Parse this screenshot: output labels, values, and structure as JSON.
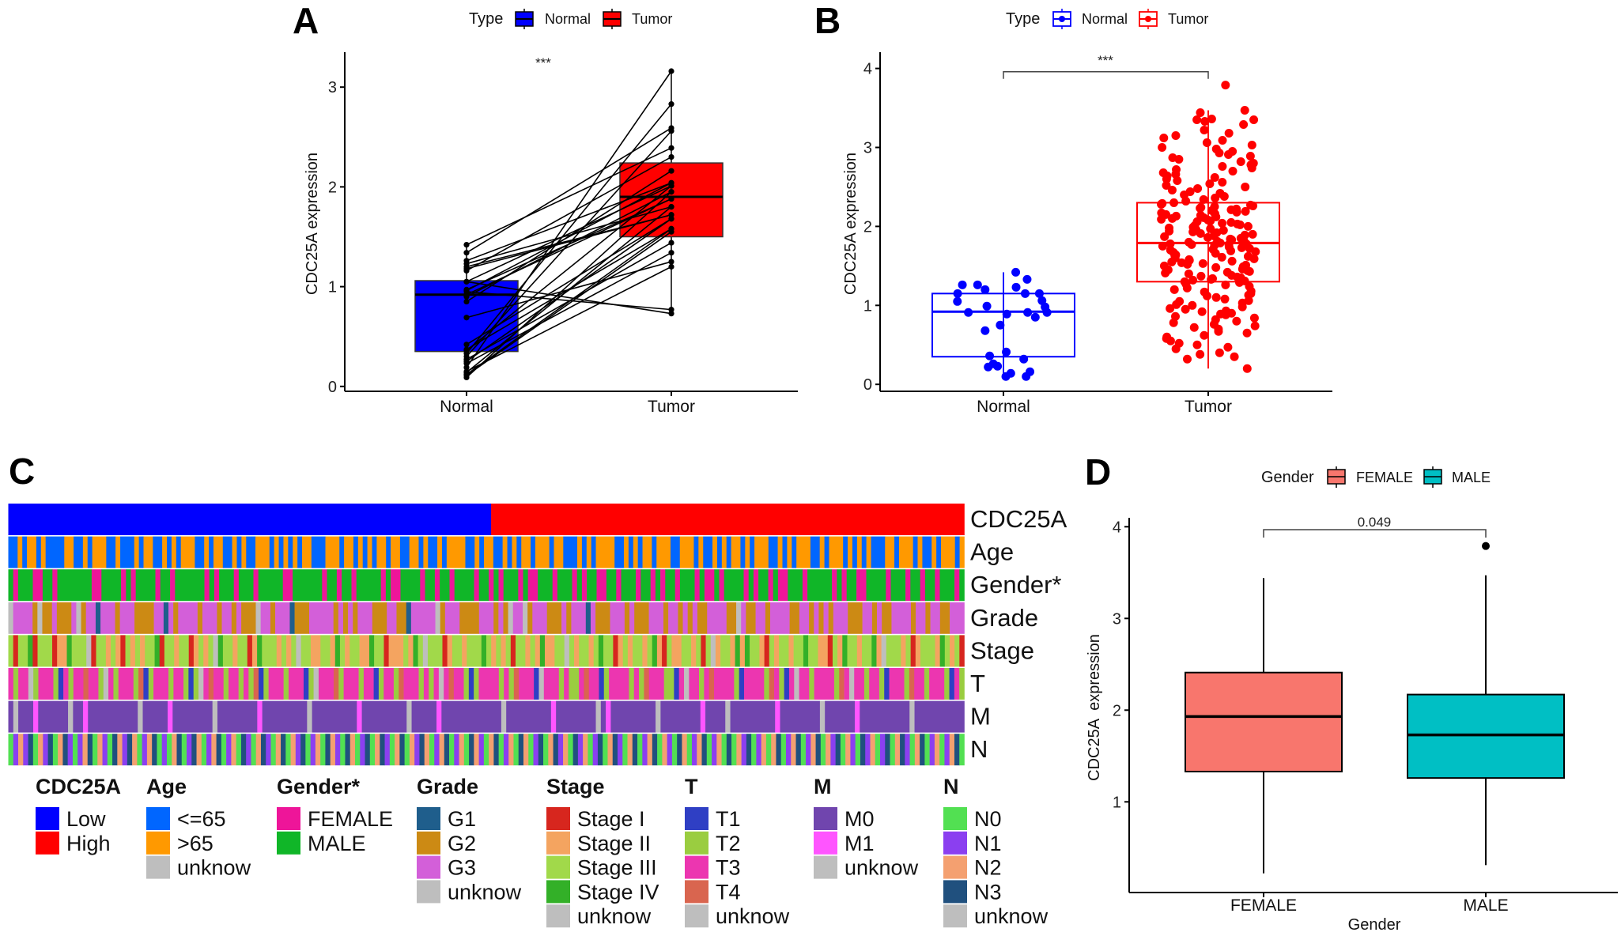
{
  "chart_data": [
    {
      "panel": "A",
      "type": "box+paired-line",
      "title": "",
      "xlabel": "",
      "ylabel": "CDC25A expression",
      "ylim": [
        0,
        3.3
      ],
      "yticks": [
        0,
        1,
        2,
        3
      ],
      "categories": [
        "Normal",
        "Tumor"
      ],
      "significance": "***",
      "legend": {
        "title": "Type",
        "position": "top",
        "items": [
          {
            "label": "Normal",
            "color": "#0000FF"
          },
          {
            "label": "Tumor",
            "color": "#FF0000"
          }
        ]
      },
      "boxes": [
        {
          "category": "Normal",
          "q1": 0.35,
          "median": 0.92,
          "q3": 1.06,
          "whisker_low": 0.09,
          "whisker_high": 1.42,
          "fill": "#0000FF"
        },
        {
          "category": "Tumor",
          "q1": 1.5,
          "median": 1.9,
          "q3": 2.24,
          "whisker_low": 0.73,
          "whisker_high": 3.16,
          "fill": "#FF0000"
        }
      ],
      "pairs": {
        "normal": [
          1.42,
          1.34,
          1.26,
          1.23,
          1.2,
          1.16,
          1.05,
          0.97,
          0.95,
          0.9,
          0.85,
          0.69,
          0.42,
          0.37,
          0.33,
          0.3,
          0.27,
          0.23,
          0.19,
          0.15,
          0.11,
          0.09,
          1.18,
          1.05,
          0.96,
          0.92,
          0.36,
          0.25,
          0.14,
          0.12
        ],
        "tumor": [
          2.39,
          2.59,
          2.04,
          1.8,
          1.72,
          2.3,
          2.01,
          1.88,
          0.77,
          1.95,
          2.16,
          1.25,
          1.68,
          1.58,
          2.83,
          2.56,
          1.44,
          1.34,
          3.16,
          1.2,
          1.55,
          1.95,
          1.72,
          0.73,
          2.04,
          1.88,
          2.01,
          1.68,
          1.8,
          1.58
        ]
      }
    },
    {
      "panel": "B",
      "type": "box+jitter",
      "xlabel": "",
      "ylabel": "CDC25A expression",
      "ylim": [
        0,
        4.1
      ],
      "yticks": [
        0,
        1,
        2,
        3,
        4
      ],
      "categories": [
        "Normal",
        "Tumor"
      ],
      "significance": "***",
      "legend": {
        "title": "Type",
        "position": "top",
        "items": [
          {
            "label": "Normal",
            "color": "#0000FF"
          },
          {
            "label": "Tumor",
            "color": "#FF0000"
          }
        ]
      },
      "boxes": [
        {
          "category": "Normal",
          "q1": 0.35,
          "median": 0.92,
          "q3": 1.15,
          "whisker_low": 0.1,
          "whisker_high": 1.42,
          "color": "#0000FF"
        },
        {
          "category": "Tumor",
          "q1": 1.3,
          "median": 1.79,
          "q3": 2.3,
          "whisker_low": 0.2,
          "whisker_high": 3.47,
          "color": "#FF0000"
        }
      ],
      "points": {
        "Normal": [
          1.42,
          1.33,
          1.26,
          1.26,
          1.23,
          1.2,
          1.15,
          1.15,
          1.15,
          1.06,
          1.05,
          0.99,
          0.98,
          0.91,
          0.91,
          0.91,
          0.89,
          0.85,
          0.75,
          0.68,
          0.41,
          0.36,
          0.32,
          0.26,
          0.23,
          0.22,
          0.16,
          0.14,
          0.1,
          0.1
        ],
        "Tumor": [
          0.2,
          0.32,
          0.35,
          0.38,
          0.4,
          0.45,
          0.47,
          0.5,
          0.52,
          0.55,
          0.58,
          0.6,
          0.62,
          0.65,
          0.67,
          0.7,
          0.72,
          0.74,
          0.76,
          0.78,
          0.8,
          0.82,
          0.84,
          0.86,
          0.88,
          0.89,
          0.9,
          0.92,
          0.93,
          0.95,
          0.96,
          0.98,
          1.0,
          1.01,
          1.03,
          1.05,
          1.06,
          1.08,
          1.1,
          1.12,
          1.13,
          1.15,
          1.17,
          1.18,
          1.2,
          1.22,
          1.24,
          1.26,
          1.27,
          1.29,
          1.3,
          1.31,
          1.32,
          1.33,
          1.34,
          1.35,
          1.36,
          1.37,
          1.38,
          1.4,
          1.41,
          1.42,
          1.43,
          1.44,
          1.45,
          1.46,
          1.48,
          1.49,
          1.5,
          1.51,
          1.52,
          1.53,
          1.54,
          1.55,
          1.56,
          1.57,
          1.58,
          1.59,
          1.6,
          1.61,
          1.62,
          1.63,
          1.64,
          1.65,
          1.66,
          1.67,
          1.68,
          1.69,
          1.7,
          1.71,
          1.72,
          1.73,
          1.74,
          1.75,
          1.76,
          1.77,
          1.77,
          1.78,
          1.78,
          1.79,
          1.8,
          1.81,
          1.82,
          1.83,
          1.84,
          1.85,
          1.86,
          1.87,
          1.88,
          1.89,
          1.9,
          1.91,
          1.92,
          1.93,
          1.94,
          1.95,
          1.96,
          1.97,
          1.98,
          1.99,
          2.0,
          2.01,
          2.02,
          2.03,
          2.04,
          2.05,
          2.06,
          2.07,
          2.08,
          2.09,
          2.1,
          2.11,
          2.12,
          2.13,
          2.14,
          2.15,
          2.16,
          2.17,
          2.18,
          2.19,
          2.2,
          2.21,
          2.22,
          2.23,
          2.24,
          2.25,
          2.26,
          2.27,
          2.28,
          2.29,
          2.3,
          2.32,
          2.34,
          2.36,
          2.38,
          2.4,
          2.42,
          2.44,
          2.46,
          2.48,
          2.5,
          2.52,
          2.54,
          2.56,
          2.58,
          2.6,
          2.62,
          2.64,
          2.66,
          2.68,
          2.7,
          2.72,
          2.74,
          2.76,
          2.78,
          2.8,
          2.82,
          2.85,
          2.87,
          2.89,
          2.91,
          2.93,
          2.95,
          2.98,
          3.0,
          3.03,
          3.06,
          3.09,
          3.12,
          3.15,
          3.18,
          3.22,
          3.29,
          3.33,
          3.35,
          3.35,
          3.36,
          3.44,
          3.47,
          3.79
        ]
      }
    },
    {
      "panel": "C",
      "type": "heatmap",
      "description": "Clinical annotation heatmap sorted by CDC25A expression (Low | High)",
      "rows": [
        {
          "name": "CDC25A",
          "codes": "LLLLLLLLLLLLLLLLLLLLLLLLLLLLLLLLLLLLLLLLLLLLLLLLLLLLLLLLLLLLLLLLLLLLLLLLLLLLLLLLLLLLLLLLLLLLLLLLLLLLHHHHHHHHHHHHHHHHHHHHHHHHHHHHHHHHHHHHHHHHHHHHHHHHHHHHHHHHHHHHHHHHHHHHHHHHHHHHHHHHHHHHHHHHHHHHHHHHHH"
        },
        {
          "name": "Age",
          "codes": "aababbabaaaabbaababbbaabaaababbaabababbbaababbaababaabbbababababbaaabbbabbabababbabbaabbabaababbbbaababbaabababbabbbabbaaabababbbbaabababbabbbaabbbabaabababbababbbaabababbbaababbbabababaaabbabbbabaababbbab"
        },
        {
          "name": "Gender*",
          "codes": "MFMMMFFMMFMMMMMMMFFMMMMFMFMMMMFMMFMMMMMMFMFMMMFMMMFMMMMMFFMMMMMMFMMFMMFMMMMMFMFFMMMMFMMFMMFMMMMFMMFMFMMMFMFFMMMFMMMFMFMMFFMMFMMMFMMFMFMMFMMMFMFFMFMMMMFMFMMFMFFMMMFMMMMMFMFMMFFMMMMFMMMFMMFMMFMMMFM"
        },
        {
          "name": "Grade",
          "codes": "u33332u2232223u233133323332222331323333233323323222u332333122233333232323332223322133333u23332222333232u33u2333222323331322233323222333233232322333322u3223323333223323232333222332322333323323322333"
        },
        {
          "name": "Stage",
          "codes": "3133413331224333u1332321323233413323312323u4332331243332323u3322332432332243312223243u3331233233343232313323242233u32332343312323323421322332313u2332424332132332334332213243323342u3332312333243231"
        },
        {
          "name": "T",
          "codes": "3233u23332132334332u323332412333233212u3433233232412333233312u333423332331233243332323u3433212333323243331u3332322343312333323243332213u332343333213333243213u3323333243u3323321333243323332132"
        },
        {
          "name": "M",
          "codes": "0u0001000000u0010000000000u00000100000000u000000001000000000u0000000001000000000u000001000000000000u000000000100000000u01000000000u0000000010000u000000000100000000u00000010000000000u0000000000"
        },
        {
          "name": "N",
          "codes": "0121302130231012302103213201230102301320123012031023102302130120321032013023102302132012301203210230120320130231203120130231023012302103201230120302130120230123012302130210312013023102301201230"
        }
      ],
      "legend": [
        {
          "title": "CDC25A",
          "items": [
            {
              "code": "L",
              "label": "Low",
              "color": "#0000FF"
            },
            {
              "code": "H",
              "label": "High",
              "color": "#FF0000"
            }
          ]
        },
        {
          "title": "Age",
          "items": [
            {
              "code": "a",
              "label": "<=65",
              "color": "#0066FF"
            },
            {
              "code": "b",
              "label": ">65",
              "color": "#FF9900"
            },
            {
              "code": "u",
              "label": "unknow",
              "color": "#BEBEBE"
            }
          ]
        },
        {
          "title": "Gender*",
          "items": [
            {
              "code": "F",
              "label": "FEMALE",
              "color": "#EE1599"
            },
            {
              "code": "M",
              "label": "MALE",
              "color": "#10B628"
            }
          ]
        },
        {
          "title": "Grade",
          "items": [
            {
              "code": "1",
              "label": "G1",
              "color": "#1F5E8C"
            },
            {
              "code": "2",
              "label": "G2",
              "color": "#CC8A14"
            },
            {
              "code": "3",
              "label": "G3",
              "color": "#D35FD9"
            },
            {
              "code": "u",
              "label": "unknow",
              "color": "#BEBEBE"
            }
          ]
        },
        {
          "title": "Stage",
          "items": [
            {
              "code": "1",
              "label": "Stage I",
              "color": "#D7261E"
            },
            {
              "code": "2",
              "label": "Stage II",
              "color": "#F4A460"
            },
            {
              "code": "3",
              "label": "Stage III",
              "color": "#A1D94A"
            },
            {
              "code": "4",
              "label": "Stage IV",
              "color": "#33B028"
            },
            {
              "code": "u",
              "label": "unknow",
              "color": "#BEBEBE"
            }
          ]
        },
        {
          "title": "T",
          "items": [
            {
              "code": "1",
              "label": "T1",
              "color": "#2F3FC4"
            },
            {
              "code": "2",
              "label": "T2",
              "color": "#9ACD40"
            },
            {
              "code": "3",
              "label": "T3",
              "color": "#EC36B0"
            },
            {
              "code": "4",
              "label": "T4",
              "color": "#D9654F"
            },
            {
              "code": "u",
              "label": "unknow",
              "color": "#BEBEBE"
            }
          ]
        },
        {
          "title": "M",
          "items": [
            {
              "code": "0",
              "label": "M0",
              "color": "#7045AE"
            },
            {
              "code": "1",
              "label": "M1",
              "color": "#FF55FF"
            },
            {
              "code": "u",
              "label": "unknow",
              "color": "#BEBEBE"
            }
          ]
        },
        {
          "title": "N",
          "items": [
            {
              "code": "0",
              "label": "N0",
              "color": "#52E052"
            },
            {
              "code": "1",
              "label": "N1",
              "color": "#8B3FF0"
            },
            {
              "code": "2",
              "label": "N2",
              "color": "#F4A070"
            },
            {
              "code": "3",
              "label": "N3",
              "color": "#20507E"
            },
            {
              "code": "u",
              "label": "unknow",
              "color": "#BEBEBE"
            }
          ]
        }
      ]
    },
    {
      "panel": "D",
      "type": "box",
      "xlabel": "Gender",
      "ylabel": "CDC25A  expression",
      "ylim": [
        0,
        4.1
      ],
      "yticks": [
        1,
        2,
        3,
        4
      ],
      "categories": [
        "FEMALE",
        "MALE"
      ],
      "p_value": "0.049",
      "legend": {
        "title": "Gender",
        "position": "top",
        "items": [
          {
            "label": "FEMALE",
            "color": "#F8766D"
          },
          {
            "label": "MALE",
            "color": "#00BFC4"
          }
        ]
      },
      "boxes": [
        {
          "category": "FEMALE",
          "q1": 1.33,
          "median": 1.93,
          "q3": 2.41,
          "whisker_low": 0.22,
          "whisker_high": 3.44,
          "fill": "#F8766D",
          "outliers": []
        },
        {
          "category": "MALE",
          "q1": 1.26,
          "median": 1.73,
          "q3": 2.17,
          "whisker_low": 0.31,
          "whisker_high": 3.47,
          "fill": "#00BFC4",
          "outliers": [
            3.79
          ]
        }
      ]
    }
  ],
  "labels": {
    "a": "A",
    "b": "B",
    "c": "C",
    "d": "D"
  }
}
